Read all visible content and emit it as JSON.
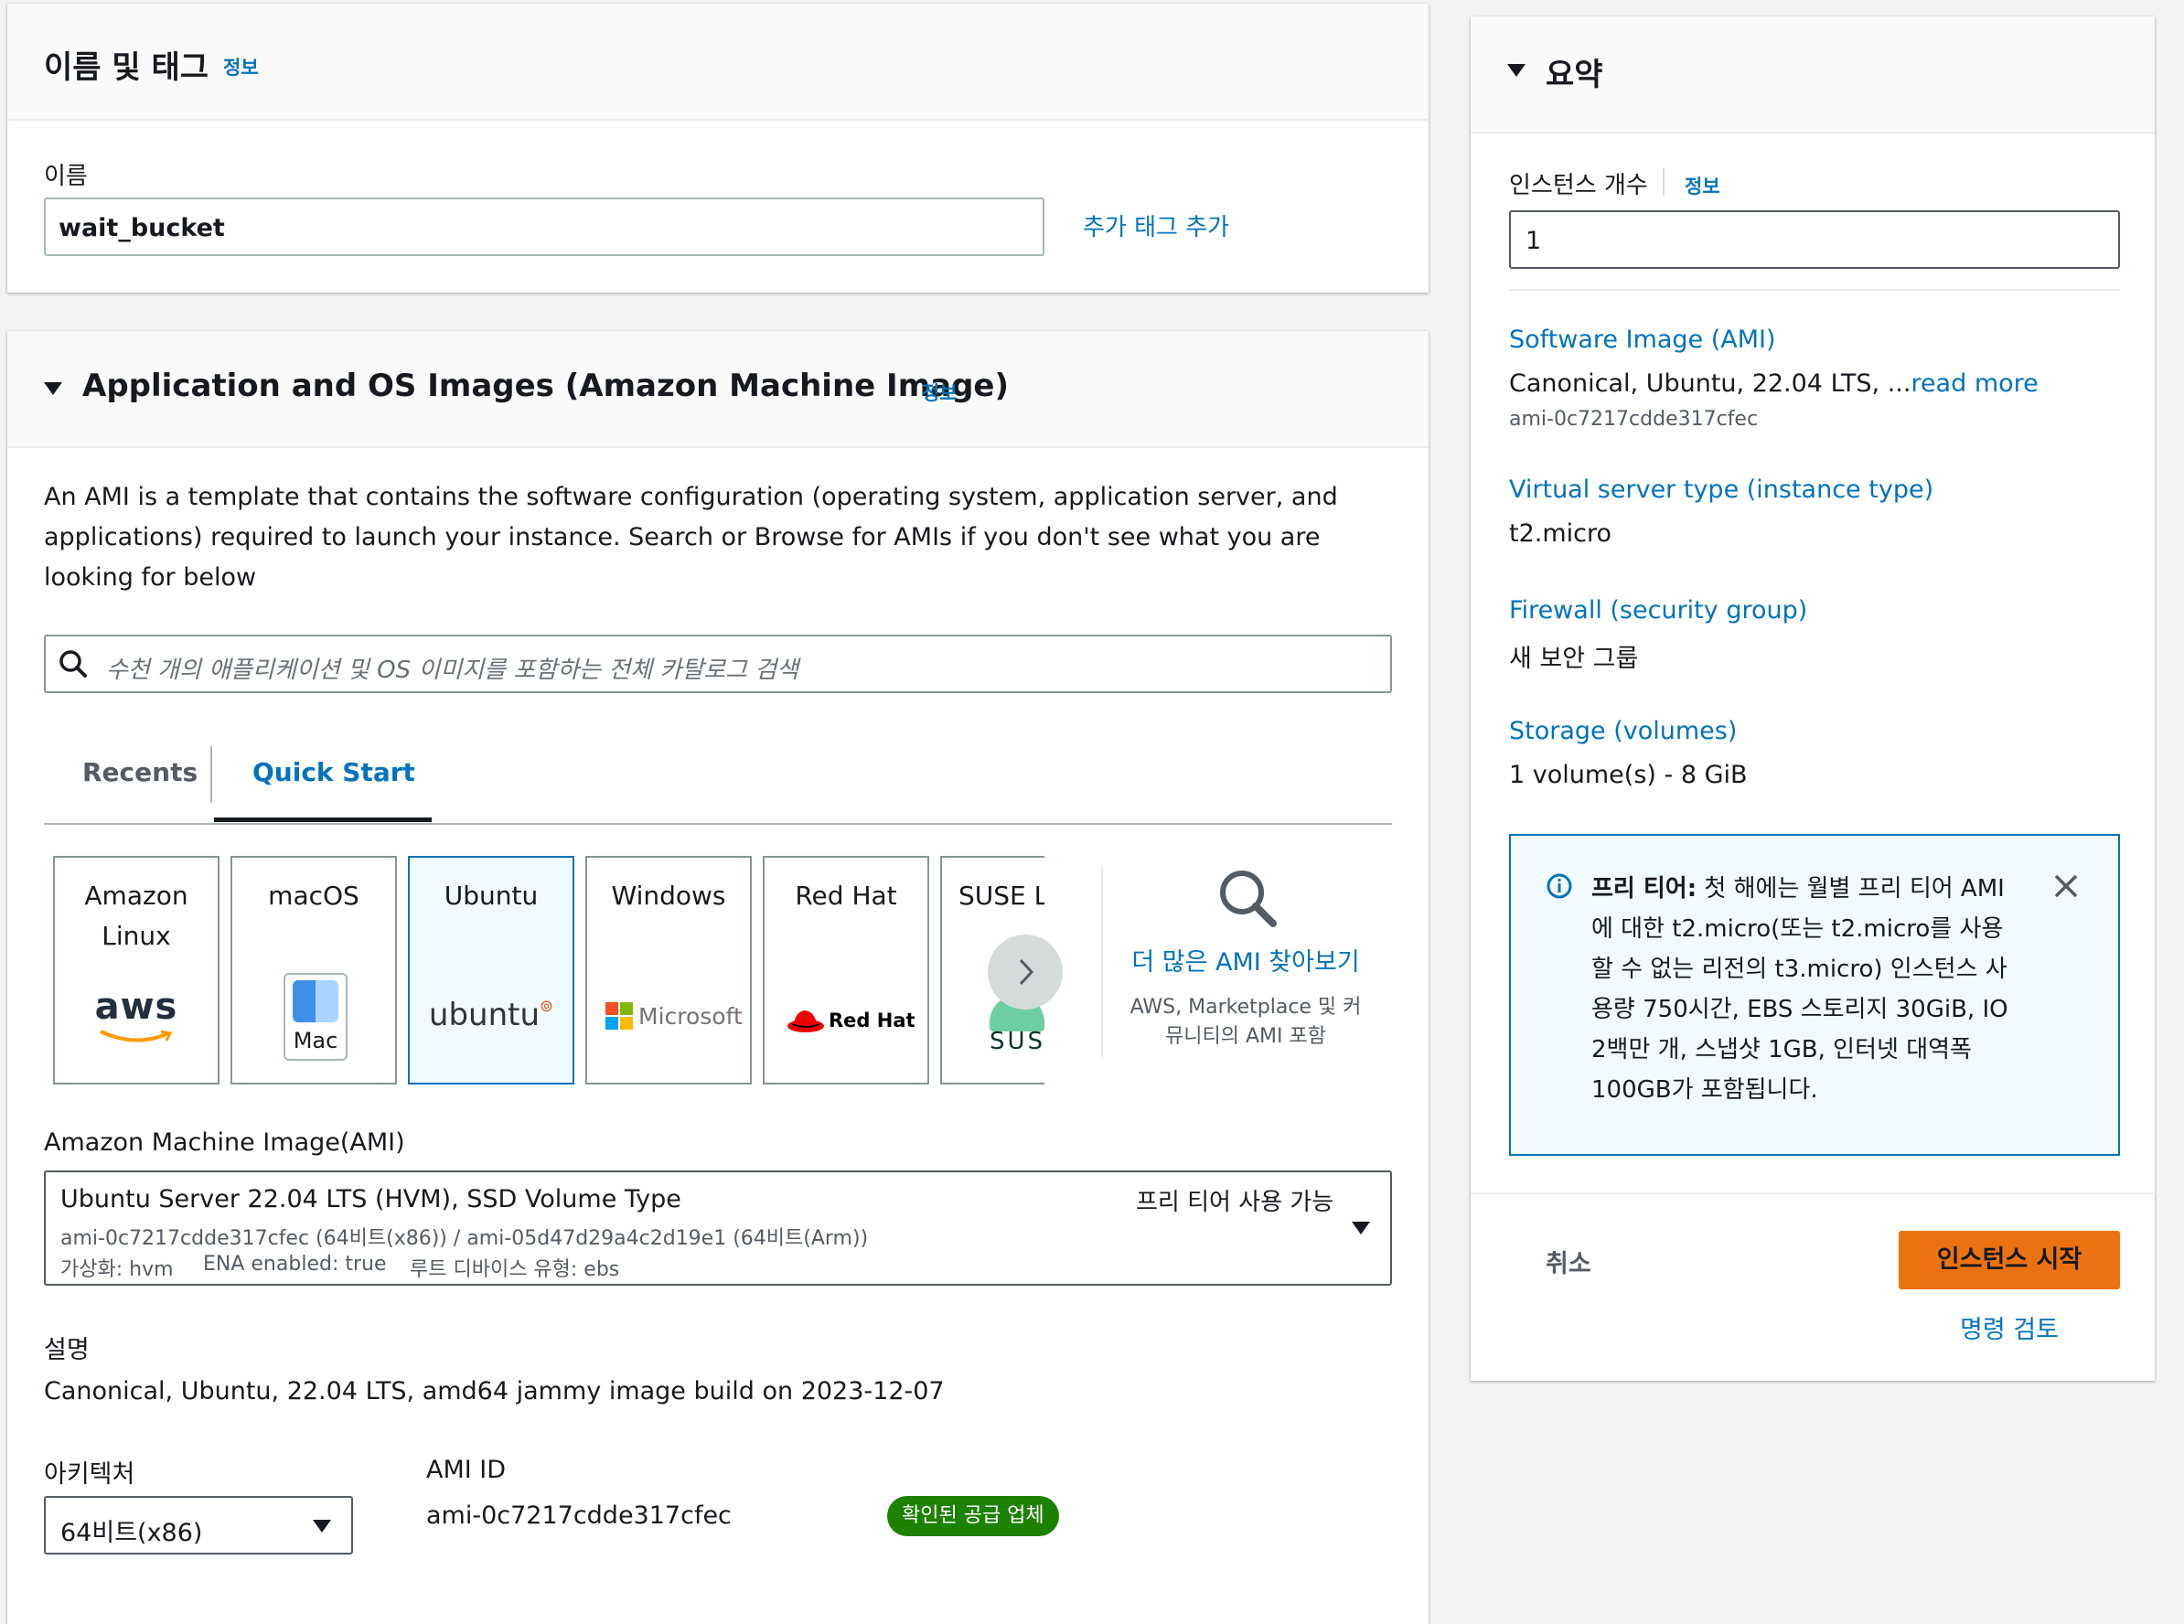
{
  "name_tags": {
    "title": "이름 및 태그",
    "info": "정보",
    "name_label": "이름",
    "name_value": "wait_bucket",
    "add_tags": "추가 태그 추가"
  },
  "ami_section": {
    "title": "Application and OS Images (Amazon Machine Image)",
    "info": "정보",
    "description": "An AMI is a template that contains the software configuration (operating system, application server, and applications) required to launch your instance. Search or Browse for AMIs if you don't see what you are looking for below",
    "search_placeholder": "수천 개의 애플리케이션 및 OS 이미지를 포함하는 전체 카탈로그 검색",
    "tabs": [
      {
        "label": "Recents"
      },
      {
        "label": "Quick Start"
      }
    ],
    "os_tiles": [
      {
        "line1": "Amazon",
        "line2": "Linux",
        "logo": "aws"
      },
      {
        "line1": "macOS",
        "logo": "Mac"
      },
      {
        "line1": "Ubuntu",
        "logo": "ubuntu"
      },
      {
        "line1": "Windows",
        "logo": "Microsoft"
      },
      {
        "line1": "Red Hat",
        "logo": "Red Hat"
      },
      {
        "line1": "SUSE Li",
        "logo": "SUS"
      }
    ],
    "browse_more": "더 많은 AMI 찾아보기",
    "browse_note": "AWS, Marketplace 및 커뮤니티의 AMI 포함",
    "ami_label": "Amazon Machine Image(AMI)",
    "ami_select": {
      "name": "Ubuntu Server 22.04 LTS (HVM), SSD Volume Type",
      "free_tier": "프리 티어 사용 가능",
      "ids": "ami-0c7217cdde317cfec (64비트(x86)) / ami-05d47d29a4c2d19e1 (64비트(Arm))",
      "virt": "가상화: hvm",
      "ena": "ENA enabled: true",
      "root": "루트 디바이스 유형: ebs"
    },
    "desc_label": "설명",
    "desc_value": "Canonical, Ubuntu, 22.04 LTS, amd64 jammy image build on 2023-12-07",
    "arch_label": "아키텍처",
    "arch_value": "64비트(x86)",
    "ami_id_label": "AMI ID",
    "ami_id_value": "ami-0c7217cdde317cfec",
    "verified_badge": "확인된 공급 업체"
  },
  "summary": {
    "title": "요약",
    "count_label": "인스턴스 개수",
    "info": "정보",
    "count_value": "1",
    "ami_label": "Software Image (AMI)",
    "ami_text": "Canonical, Ubuntu, 22.04 LTS, ...",
    "read_more": "read more",
    "ami_id": "ami-0c7217cdde317cfec",
    "type_label": "Virtual server type (instance type)",
    "type_value": "t2.micro",
    "firewall_label": "Firewall (security group)",
    "firewall_value": "새 보안 그룹",
    "storage_label": "Storage (volumes)",
    "storage_value": "1 volume(s) - 8 GiB",
    "free_tier_title": "프리 티어:",
    "free_tier_text": "첫 해에는 월별 프리 티어 AMI에 대한 t2.micro(또는 t2.micro를 사용할 수 없는 리전의 t3.micro) 인스턴스 사용량 750시간, EBS 스토리지 30GiB, IO 2백만 개, 스냅샷 1GB, 인터넷 대역폭 100GB가 포함됩니다.",
    "cancel": "취소",
    "launch": "인스턴스 시작",
    "review": "명령 검토"
  },
  "colors": {
    "accent": "#0073bb",
    "primary_button": "#ec7211",
    "badge": "#1d8102",
    "selected_tile_bg": "#f1faff"
  }
}
